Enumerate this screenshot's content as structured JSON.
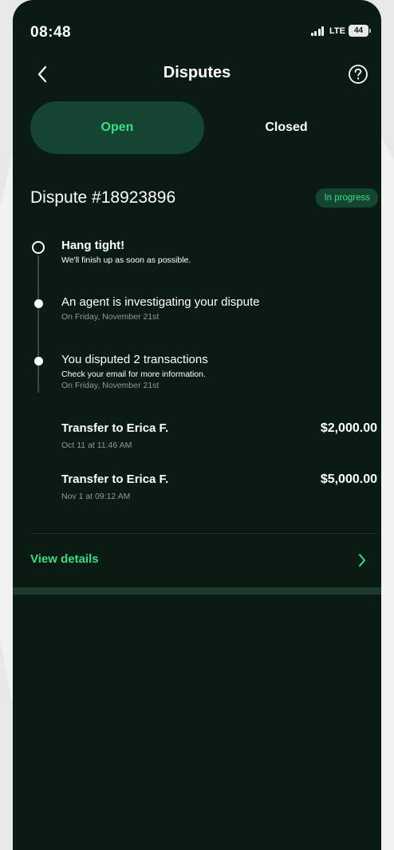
{
  "status_bar": {
    "time": "08:48",
    "network": "LTE",
    "battery": "44"
  },
  "nav": {
    "title": "Disputes",
    "back_icon": "chevron-left-icon",
    "help_icon": "help-circle-icon"
  },
  "tabs": [
    {
      "label": "Open",
      "selected": true
    },
    {
      "label": "Closed",
      "selected": false
    }
  ],
  "dispute": {
    "title": "Dispute #18923896",
    "status": "In progress"
  },
  "timeline": [
    {
      "title": "Hang tight!",
      "subtitle": "We'll finish up as soon as possible.",
      "date": ""
    },
    {
      "title": "An agent is investigating your dispute",
      "subtitle": "",
      "date": "On Friday, November 21st"
    },
    {
      "title": "You disputed 2 transactions",
      "subtitle": "Check your email for more information.",
      "date": "On Friday, November 21st"
    }
  ],
  "transactions": [
    {
      "name": "Transfer to Erica F.",
      "date": "Oct 11 at 11:46 AM",
      "amount": "$2,000.00"
    },
    {
      "name": "Transfer to Erica F.",
      "date": "Nov 1 at 09:12 AM",
      "amount": "$5,000.00"
    }
  ],
  "view_details": {
    "label": "View details",
    "icon": "chevron-right-icon"
  },
  "colors": {
    "background": "#0a1b14",
    "accent": "#3ddc84",
    "selected_pill": "#134532"
  }
}
